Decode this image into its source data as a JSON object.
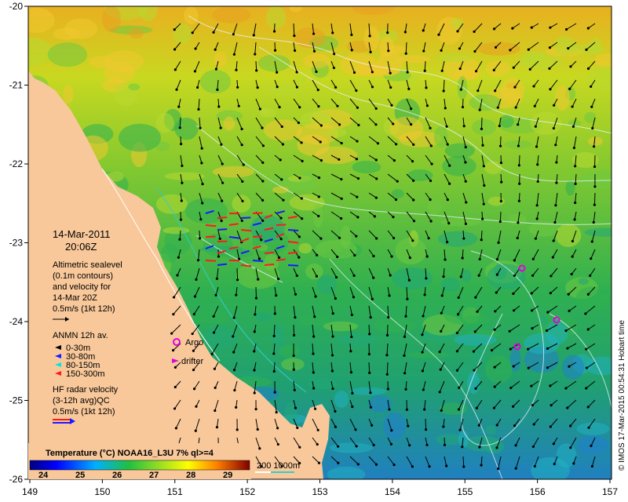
{
  "map": {
    "x_ticks": [
      "149",
      "150",
      "151",
      "152",
      "153",
      "154",
      "155",
      "156",
      "157"
    ],
    "y_ticks": [
      "-20",
      "-21",
      "-22",
      "-23",
      "-24",
      "-25",
      "-26"
    ]
  },
  "legend": {
    "date": "14-Mar-2011",
    "time": "20:06Z",
    "altimetry": [
      "Altimetric sealevel",
      "(0.1m contours)",
      "and velocity for",
      "14-Mar 20Z",
      "0.5m/s (1kt 12h)"
    ],
    "anmn_title": "ANMN 12h av.",
    "anmn_items": [
      {
        "label": "0-30m",
        "color": "#000000"
      },
      {
        "label": "30-80m",
        "color": "#1a1aff"
      },
      {
        "label": "80-150m",
        "color": "#00e5e5"
      },
      {
        "label": "150-300m",
        "color": "#ff1a1a"
      }
    ],
    "argo_label": "Argo",
    "drifter_label": "drifter",
    "hf_radar": [
      "HF radar velocity",
      "(3-12h avg)QC",
      "0.5m/s (1kt 12h)"
    ],
    "colorbar_title": "Temperature (°C) NOAA16_L3U 7% ql>=4",
    "colorbar_ticks": [
      "24",
      "25",
      "26",
      "27",
      "28",
      "29"
    ],
    "depth_label": "200  1000m",
    "credit": "© IMOS 17-Mar-2015 00:54:31 Hobart time"
  },
  "colors": {
    "land": "#f8c89a",
    "argo": "#e000e0",
    "drifter": "#e000e0",
    "contour": "#e8f4ff",
    "depth200": "#ffffff",
    "depth1000": "#33cccc"
  }
}
